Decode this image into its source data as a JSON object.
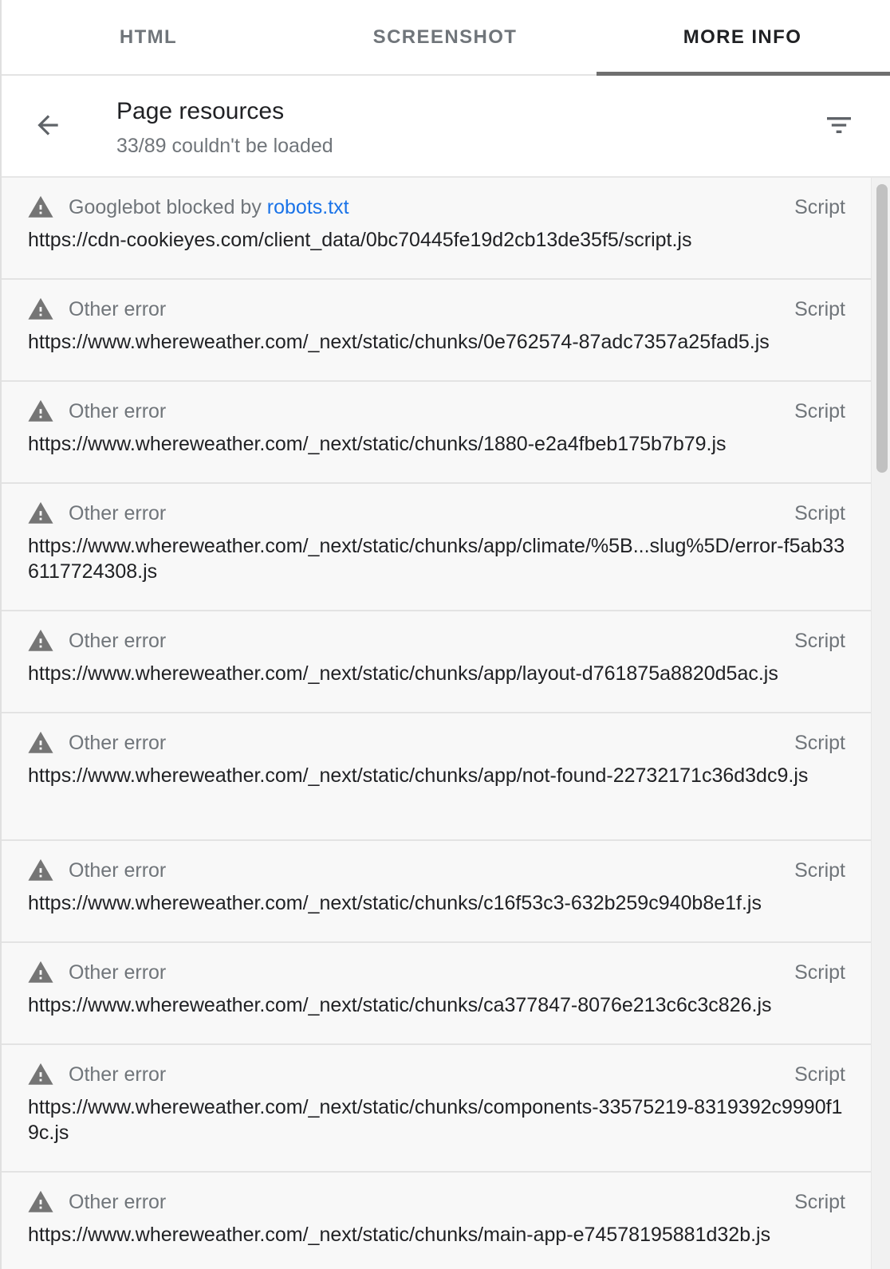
{
  "tabs": [
    {
      "label": "HTML"
    },
    {
      "label": "SCREENSHOT"
    },
    {
      "label": "MORE INFO"
    }
  ],
  "header": {
    "title": "Page resources",
    "subtitle": "33/89 couldn't be loaded"
  },
  "icons": {
    "back": "arrow-back-icon",
    "filter": "filter-icon",
    "warning": "warning-icon"
  },
  "colors": {
    "link": "#1a73e8",
    "secondary_text": "#70757a",
    "warning_icon": "#757575"
  },
  "resources": [
    {
      "status_prefix": "Googlebot blocked by ",
      "status_link": "robots.txt",
      "type": "Script",
      "url": "https://cdn-cookieyes.com/client_data/0bc70445fe19d2cb13de35f5/script.js"
    },
    {
      "status": "Other error",
      "type": "Script",
      "url": "https://www.whereweather.com/_next/static/chunks/0e762574-87adc7357a25fad5.js"
    },
    {
      "status": "Other error",
      "type": "Script",
      "url": "https://www.whereweather.com/_next/static/chunks/1880-e2a4fbeb175b7b79.js"
    },
    {
      "status": "Other error",
      "type": "Script",
      "url": "https://www.whereweather.com/_next/static/chunks/app/climate/%5B...slug%5D/error-f5ab336117724308.js"
    },
    {
      "status": "Other error",
      "type": "Script",
      "url": "https://www.whereweather.com/_next/static/chunks/app/layout-d761875a8820d5ac.js"
    },
    {
      "status": "Other error",
      "type": "Script",
      "url": "https://www.whereweather.com/_next/static/chunks/app/not-found-22732171c36d3dc9.js"
    },
    {
      "status": "Other error",
      "type": "Script",
      "url": "https://www.whereweather.com/_next/static/chunks/c16f53c3-632b259c940b8e1f.js"
    },
    {
      "status": "Other error",
      "type": "Script",
      "url": "https://www.whereweather.com/_next/static/chunks/ca377847-8076e213c6c3c826.js"
    },
    {
      "status": "Other error",
      "type": "Script",
      "url": "https://www.whereweather.com/_next/static/chunks/components-33575219-8319392c9990f19c.js"
    },
    {
      "status": "Other error",
      "type": "Script",
      "url": "https://www.whereweather.com/_next/static/chunks/main-app-e74578195881d32b.js"
    }
  ]
}
